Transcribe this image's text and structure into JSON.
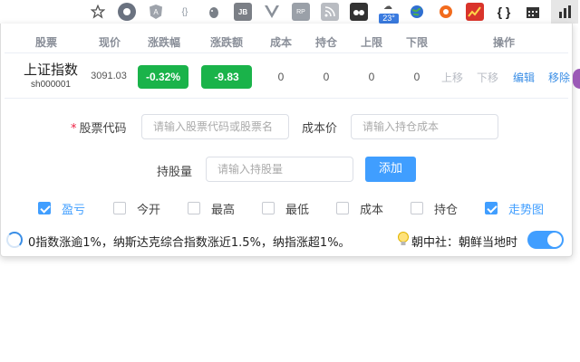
{
  "toolbar": {
    "icons": [
      "star-icon",
      "chat-extension-icon",
      "angular-extension-icon",
      "json-extension-icon",
      "evernote-extension-icon",
      "jb-extension-icon",
      "vue-extension-icon",
      "rp-extension-icon",
      "rss-extension-icon",
      "tampermonkey-extension-icon",
      "weather-extension-icon",
      "globe-extension-icon",
      "lifebuoy-extension-icon",
      "stock-chart-extension-icon",
      "braces-extension-icon",
      "calendar-extension-icon",
      "stocks-extension-icon"
    ],
    "jb_label": "JB",
    "rp_label": "RP",
    "json_label": "{}",
    "braces_label": "{ }",
    "weather_temp": "23°"
  },
  "table": {
    "headers": [
      "股票",
      "现价",
      "涨跌幅",
      "涨跌额",
      "成本",
      "持仓",
      "上限",
      "下限",
      "操作"
    ],
    "row": {
      "name": "上证指数",
      "code": "sh000001",
      "price": "3091.03",
      "change_pct": "-0.32%",
      "change_amt": "-9.83",
      "cost": "0",
      "position": "0",
      "upper": "0",
      "lower": "0",
      "actions": [
        "上移",
        "下移",
        "编辑",
        "移除"
      ]
    }
  },
  "form": {
    "code_label": "股票代码",
    "code_placeholder": "请输入股票代码或股票名",
    "cost_label": "成本价",
    "cost_placeholder": "请输入持仓成本",
    "qty_label": "持股量",
    "qty_placeholder": "请输入持股量",
    "add_label": "添加"
  },
  "columns_toggle": [
    {
      "label": "盈亏",
      "checked": true
    },
    {
      "label": "今开",
      "checked": false
    },
    {
      "label": "最高",
      "checked": false
    },
    {
      "label": "最低",
      "checked": false
    },
    {
      "label": "成本",
      "checked": false
    },
    {
      "label": "持仓",
      "checked": false
    },
    {
      "label": "走势图",
      "checked": true
    }
  ],
  "ticker": {
    "text": "0指数涨逾1%，纳斯达克综合指数涨近1.5%，纳指涨超1%。",
    "news": "朝中社：朝鲜当地时"
  },
  "colors": {
    "down_green": "#1ab34a",
    "accent": "#409eff"
  }
}
